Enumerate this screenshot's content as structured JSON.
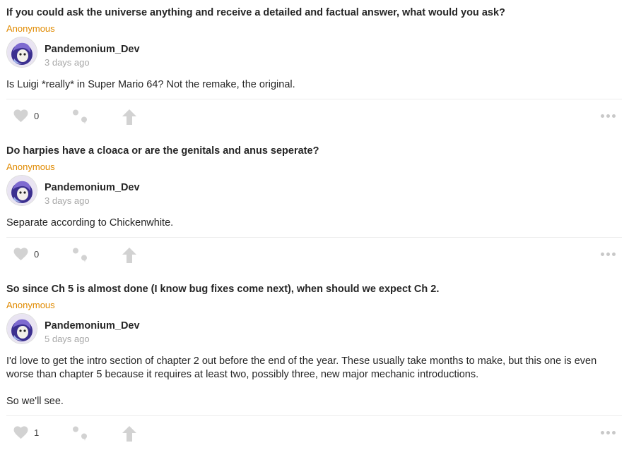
{
  "posts": [
    {
      "question": "If you could ask the universe anything and receive a detailed and factual answer, what would you ask?",
      "asker": "Anonymous",
      "author": "Pandemonium_Dev",
      "time": "3 days ago",
      "answer": [
        "Is Luigi *really* in Super Mario 64? Not the remake, the original."
      ],
      "likes": "0"
    },
    {
      "question": "Do harpies have a cloaca or are the genitals and anus seperate?",
      "asker": "Anonymous",
      "author": "Pandemonium_Dev",
      "time": "3 days ago",
      "answer": [
        "Separate according to Chickenwhite."
      ],
      "likes": "0"
    },
    {
      "question": "So since Ch 5 is almost done (I know bug fixes come next), when should we expect Ch 2.",
      "asker": "Anonymous",
      "author": "Pandemonium_Dev",
      "time": "5 days ago",
      "answer": [
        "I'd love to get the intro section of chapter 2 out before the end of the year. These usually take months to make, but this one is even worse than chapter 5 because it requires at least two, possibly three, new major mechanic introductions.",
        "So we'll see."
      ],
      "likes": "1"
    }
  ],
  "icons": {
    "like": "heart-icon",
    "quote": "quote-icon",
    "share": "share-arrow-icon",
    "more": "more-dots-icon"
  },
  "colors": {
    "asker": "#e08a00",
    "time": "#a8a8a8",
    "icon": "#d2d2d2"
  }
}
